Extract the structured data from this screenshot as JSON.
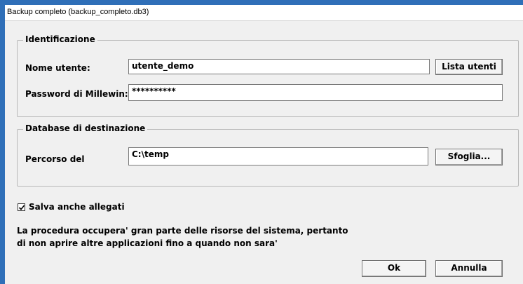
{
  "window": {
    "title": "Backup completo (backup_completo.db3)"
  },
  "identificazione": {
    "legend": "Identificazione",
    "username_label": "Nome utente:",
    "username_value": "utente_demo",
    "users_button": "Lista utenti",
    "password_label": "Password di Millewin:",
    "password_value": "**********"
  },
  "destinazione": {
    "legend": "Database di destinazione",
    "path_label": "Percorso del",
    "path_value": "C:\\temp",
    "browse_button": "Sfoglia..."
  },
  "options": {
    "save_attachments_label": "Salva anche allegati",
    "save_attachments_checked": true
  },
  "notice": {
    "line1": "La procedura occupera' gran parte delle risorse del sistema, pertanto",
    "line2": "di non aprire altre applicazioni fino a quando non sara'"
  },
  "footer": {
    "ok_label": "Ok",
    "cancel_label": "Annulla"
  },
  "colors": {
    "window_border": "#2f6fb8",
    "dialog_bg": "#f0f0f0"
  }
}
